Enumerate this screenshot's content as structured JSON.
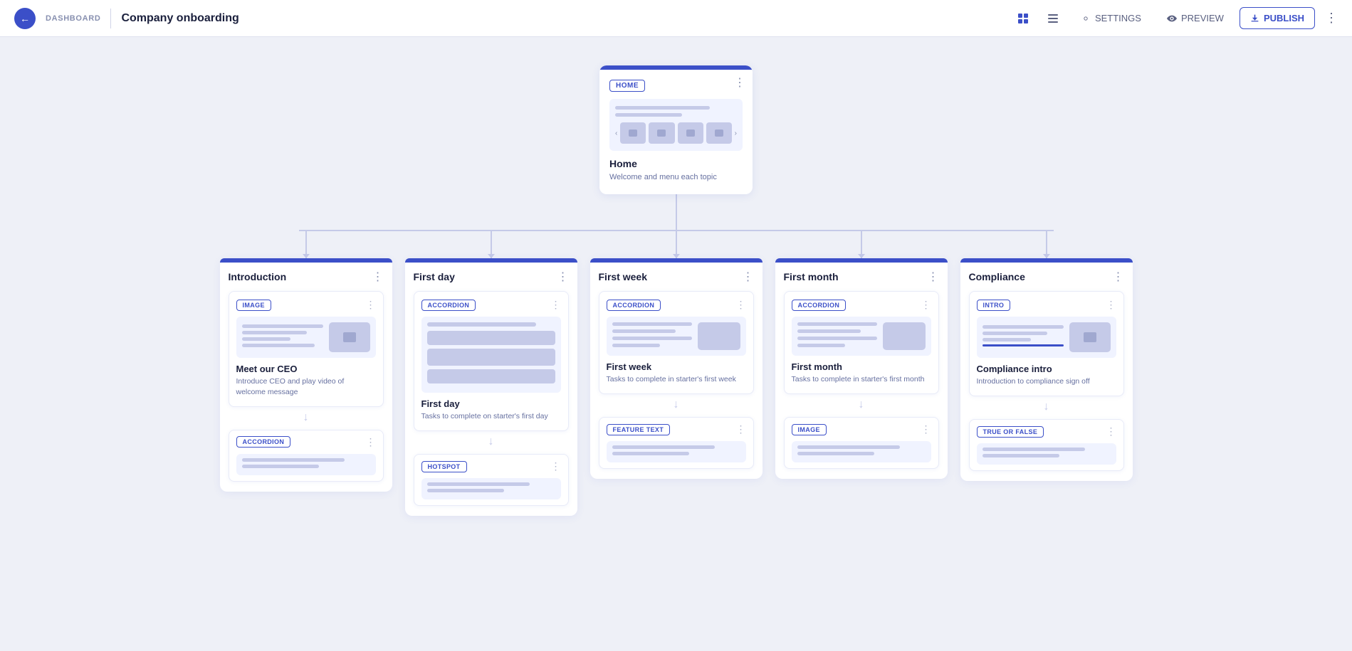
{
  "header": {
    "back_label": "DASHBOARD",
    "title": "Company onboarding",
    "settings_label": "SETTINGS",
    "preview_label": "PREVIEW",
    "publish_label": "PUBLISH"
  },
  "home_node": {
    "badge": "HOME",
    "title": "Home",
    "desc": "Welcome and menu each topic"
  },
  "sections": [
    {
      "title": "Introduction",
      "lessons": [
        {
          "badge": "IMAGE",
          "title": "Meet our CEO",
          "desc": "Introduce CEO and play video of welcome message",
          "type": "image"
        }
      ],
      "bottom_badge": "ACCORDION"
    },
    {
      "title": "First day",
      "lessons": [
        {
          "badge": "ACCORDION",
          "title": "First day",
          "desc": "Tasks to complete on starter's first day",
          "type": "accordion"
        }
      ],
      "bottom_badge": "HOTSPOT"
    },
    {
      "title": "First week",
      "lessons": [
        {
          "badge": "ACCORDION",
          "title": "First week",
          "desc": "Tasks to complete in starter's first week",
          "type": "accordion"
        }
      ],
      "bottom_badge": "FEATURE TEXT"
    },
    {
      "title": "First month",
      "lessons": [
        {
          "badge": "ACCORDION",
          "title": "First month",
          "desc": "Tasks to complete in starter's first month",
          "type": "accordion"
        }
      ],
      "bottom_badge": "IMAGE"
    },
    {
      "title": "Compliance",
      "lessons": [
        {
          "badge": "INTRO",
          "title": "Compliance intro",
          "desc": "Introduction to compliance sign off",
          "type": "intro"
        }
      ],
      "bottom_badge": "TRUE OR FALSE"
    }
  ]
}
